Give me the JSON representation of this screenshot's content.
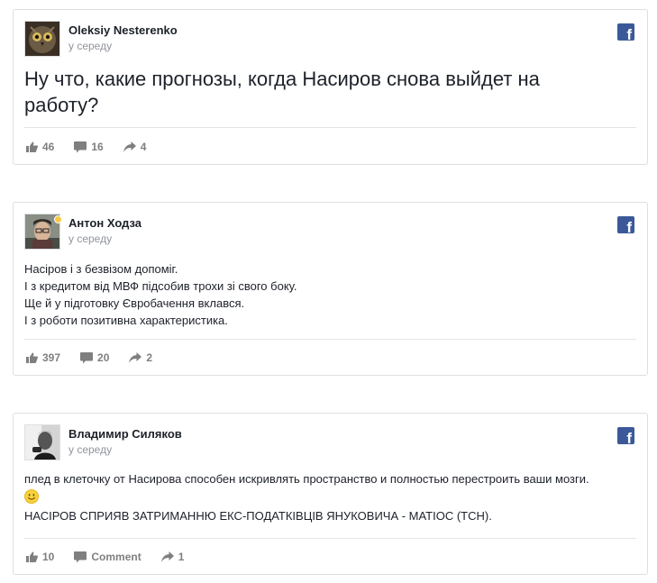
{
  "posts": [
    {
      "author": "Oleksiy Nesterenko",
      "time": "у середу",
      "text": "Ну что, какие прогнозы, когда Насиров снова выйдет на работу?",
      "likes": "46",
      "comments": "16",
      "shares": "4"
    },
    {
      "author": "Антон Ходза",
      "time": "у середу",
      "lines": [
        "Насіров і з безвізом допоміг.",
        "І з кредитом від МВФ підсобив трохи зі свого боку.",
        "Ще й у підготовку Євробачення вклався.",
        "І з роботи позитивна характеристика."
      ],
      "likes": "397",
      "comments": "20",
      "shares": "2"
    },
    {
      "author": "Владимир Силяков",
      "time": "у середу",
      "line1": "плед в клеточку от Насирова способен искривлять пространство и полностью перестроить ваши мозги.",
      "line2": "НАСІРОВ СПРИЯВ ЗАТРИМАННЮ ЕКС-ПОДАТКІВЦІВ ЯНУКОВИЧА - МАТІОС (ТСН).",
      "likes": "10",
      "comments": "Comment",
      "shares": "1"
    }
  ],
  "facebook_letter": "f",
  "icons": {
    "network": "facebook-icon",
    "like": "thumbs-up-icon",
    "comment": "comment-icon",
    "share": "share-arrow-icon",
    "emoji": "smiley-icon"
  },
  "colors": {
    "facebook_blue": "#3b5998",
    "action_gray": "#7f7f7f",
    "meta_gray": "#90949c",
    "border": "#dddfe2",
    "online": "#f7c948"
  }
}
